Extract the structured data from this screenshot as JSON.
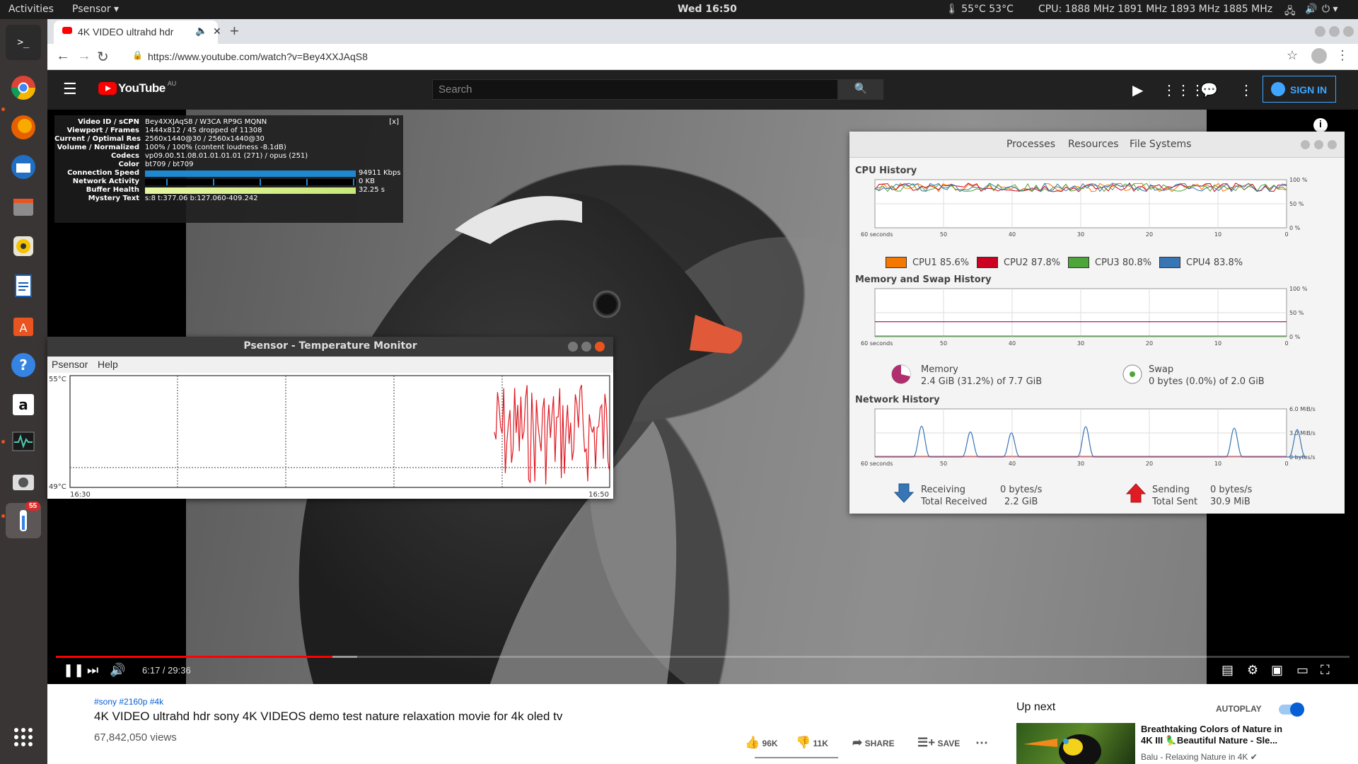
{
  "topbar": {
    "activities": "Activities",
    "app_menu": "Psensor ▾",
    "clock": "Wed 16:50",
    "temps": "🌡 55°C 53°C",
    "cpu": "CPU: 1888 MHz 1891 MHz 1893 MHz 1885 MHz"
  },
  "dock": {
    "badge": "55"
  },
  "browser": {
    "tab_title": "4K VIDEO ultrahd hdr",
    "url": "https://www.youtube.com/watch?v=Bey4XXJAqS8"
  },
  "youtube": {
    "logo": "YouTube",
    "region": "AU",
    "search_placeholder": "Search",
    "sign_in": "SIGN IN"
  },
  "stats": {
    "close": "[x]",
    "rows": [
      {
        "key": "Video ID / sCPN",
        "value": "Bey4XXJAqS8 / W3CA RP9G MQNN"
      },
      {
        "key": "Viewport / Frames",
        "value": "1444x812 / 45 dropped of 11308"
      },
      {
        "key": "Current / Optimal Res",
        "value": "2560x1440@30 / 2560x1440@30"
      },
      {
        "key": "Volume / Normalized",
        "value": "100% / 100% (content loudness -8.1dB)"
      },
      {
        "key": "Codecs",
        "value": "vp09.00.51.08.01.01.01.01 (271) / opus (251)"
      },
      {
        "key": "Color",
        "value": "bt709 / bt709"
      },
      {
        "key": "Connection Speed",
        "value": "94911 Kbps"
      },
      {
        "key": "Network Activity",
        "value": "0 KB"
      },
      {
        "key": "Buffer Health",
        "value": "32.25 s"
      },
      {
        "key": "Mystery Text",
        "value": "s:8 t:377.06 b:127.060-409.242"
      }
    ]
  },
  "player": {
    "time": "6:17 / 29:36",
    "played_fraction": 0.214,
    "buffered_fraction": 0.233
  },
  "psensor": {
    "title": "Psensor - Temperature Monitor",
    "menu": [
      "Psensor",
      "Help"
    ],
    "y_max": "55°C",
    "y_min": "49°C",
    "x_start": "16:30",
    "x_end": "16:50"
  },
  "sysmon": {
    "tabs": [
      "Processes",
      "Resources",
      "File Systems"
    ],
    "cpu_title": "CPU History",
    "mem_title": "Memory and Swap History",
    "net_title": "Network History",
    "x_ticks": [
      "60 seconds",
      "50",
      "40",
      "30",
      "20",
      "10",
      "0"
    ],
    "pct_ticks": [
      "100 %",
      "50 %",
      "0 %"
    ],
    "net_ticks": [
      "6.0 MiB/s",
      "3.0 MiB/s",
      "0 bytes/s"
    ],
    "cpus": [
      {
        "label": "CPU1  85.6%",
        "color": "#f57900"
      },
      {
        "label": "CPU2  87.8%",
        "color": "#cc0020"
      },
      {
        "label": "CPU3  80.8%",
        "color": "#4ea63a"
      },
      {
        "label": "CPU4  83.8%",
        "color": "#3875b5"
      }
    ],
    "memory_label": "Memory",
    "memory_value": "2.4 GiB (31.2%) of 7.7 GiB",
    "swap_label": "Swap",
    "swap_value": "0 bytes (0.0%) of 2.0 GiB",
    "receiving_label": "Receiving",
    "total_received_label": "Total Received",
    "receiving_rate": "0 bytes/s",
    "total_received": "2.2 GiB",
    "sending_label": "Sending",
    "total_sent_label": "Total Sent",
    "sending_rate": "0 bytes/s",
    "total_sent": "30.9 MiB"
  },
  "video": {
    "tags": "#sony #2160p #4k",
    "title": "4K VIDEO ultrahd hdr sony 4K VIDEOS demo test nature relaxation movie for 4k oled tv",
    "views": "67,842,050 views",
    "likes": "96K",
    "dislikes": "11K",
    "share": "SHARE",
    "save": "SAVE"
  },
  "sidebar": {
    "up_next": "Up next",
    "autoplay": "AUTOPLAY",
    "rec_title": "Breathtaking Colors of Nature in 4K III 🦜Beautiful Nature - Sle...",
    "rec_channel": "Balu - Relaxing Nature in 4K ✔"
  }
}
